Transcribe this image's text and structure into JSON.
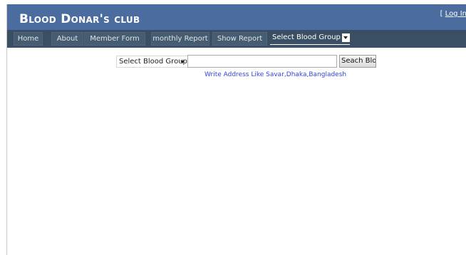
{
  "header": {
    "title": "Blood Donar's club",
    "login_prefix": "[ ",
    "login_label": "Log In"
  },
  "nav": {
    "items": [
      "Home",
      "About",
      "Member Form",
      "monthly Report",
      "Show Report"
    ],
    "select_label": "Select Blood Group"
  },
  "search": {
    "blood_group_selected": "Select Blood Group",
    "address_value": "",
    "button_label": "Seach Bloo",
    "hint": "Write Address Like Savar,Dhaka,Bangladesh"
  },
  "colors": {
    "header_bg": "#4b6c9e",
    "nav_bg": "#3a4f63",
    "nav_item_bg": "#465c71",
    "hint_text": "#3344dd"
  }
}
